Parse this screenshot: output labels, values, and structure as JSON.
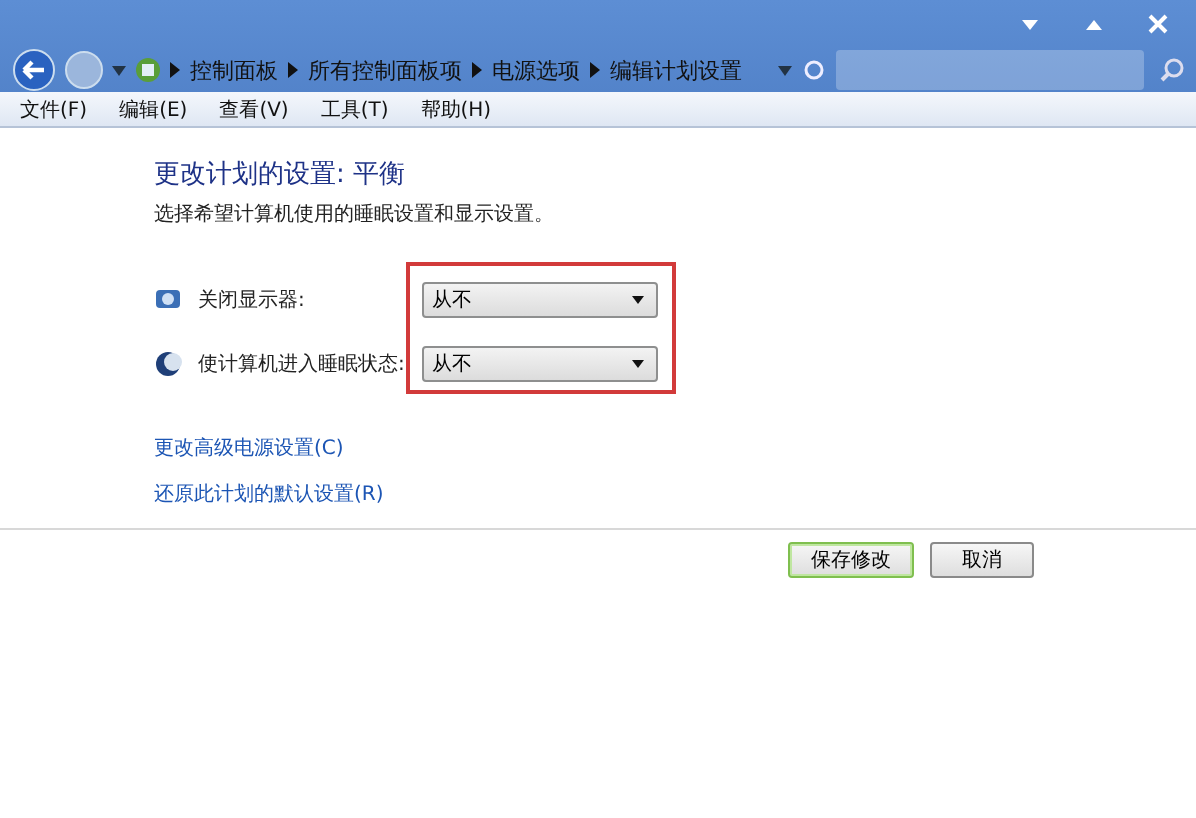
{
  "breadcrumbs": [
    "控制面板",
    "所有控制面板项",
    "电源选项",
    "编辑计划设置"
  ],
  "menu": [
    "文件(F)",
    "编辑(E)",
    "查看(V)",
    "工具(T)",
    "帮助(H)"
  ],
  "heading": "更改计划的设置: 平衡",
  "subtitle": "选择希望计算机使用的睡眠设置和显示设置。",
  "settings": [
    {
      "kind": "display",
      "label": "关闭显示器:",
      "value": "从不"
    },
    {
      "kind": "sleep",
      "label": "使计算机进入睡眠状态:",
      "value": "从不"
    }
  ],
  "links": [
    "更改高级电源设置(C)",
    "还原此计划的默认设置(R)"
  ],
  "buttons": [
    {
      "label": "保存修改",
      "selected": true
    },
    {
      "label": "取消",
      "selected": false
    }
  ]
}
